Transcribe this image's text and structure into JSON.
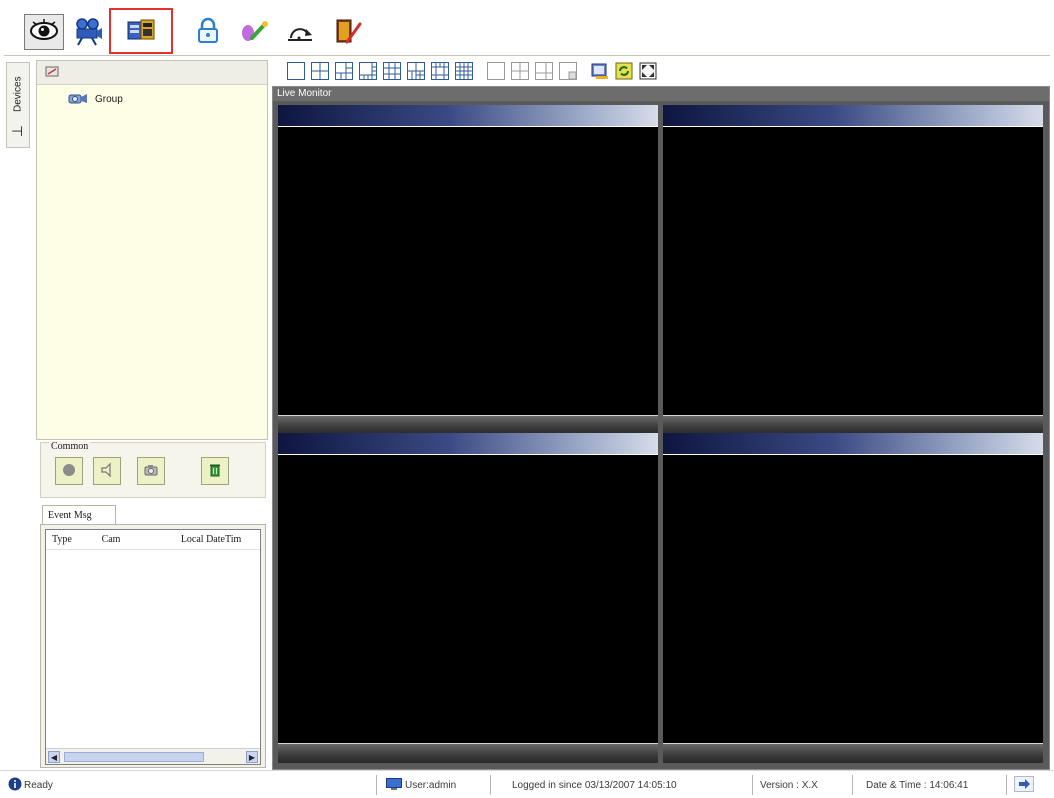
{
  "toolbar": {
    "buttons": [
      {
        "name": "live-view",
        "icon": "eye-icon"
      },
      {
        "name": "playback",
        "icon": "projector-icon"
      },
      {
        "name": "device-setup",
        "icon": "device-setup-icon",
        "highlighted": true
      },
      {
        "name": "lock",
        "icon": "lock-icon"
      },
      {
        "name": "tools",
        "icon": "tools-icon"
      },
      {
        "name": "logout",
        "icon": "logout-icon"
      },
      {
        "name": "exit",
        "icon": "exit-door-icon"
      }
    ],
    "highlight_color": "#e53030"
  },
  "sidebar": {
    "tab_label": "Devices",
    "tree": {
      "root_label": "Group"
    }
  },
  "common": {
    "legend": "Common",
    "buttons": [
      "record-icon",
      "speaker-icon",
      "snapshot-icon",
      "delete-icon"
    ]
  },
  "events": {
    "tab_label": "Event Msg",
    "columns": [
      "Type",
      "Cam",
      "Local DateTim"
    ]
  },
  "layout_toolbar": {
    "buttons": [
      "layout-1-icon",
      "layout-4-icon",
      "layout-6-icon",
      "layout-8-icon",
      "layout-9-icon",
      "layout-10-icon",
      "layout-13-icon",
      "layout-16-icon",
      "layout-single-icon",
      "layout-quad-icon",
      "layout-split-icon",
      "layout-corner-icon",
      "sequence-icon",
      "refresh-icon",
      "fullscreen-icon"
    ]
  },
  "live_monitor": {
    "title": "Live Monitor",
    "header_colors": [
      "#0e1640",
      "#d6dce8"
    ]
  },
  "status": {
    "ready": "Ready",
    "user": "User:admin",
    "logged_in": "Logged in since 03/13/2007 14:05:10",
    "version": "Version :  X.X",
    "datetime": "Date & Time :  14:06:41"
  }
}
